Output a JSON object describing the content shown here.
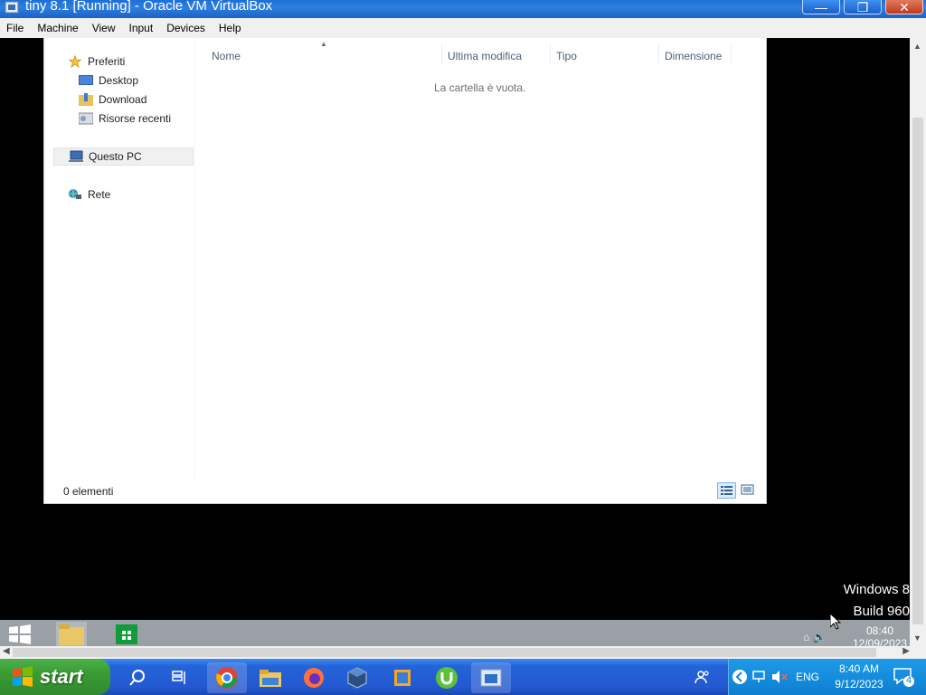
{
  "host_window": {
    "title": "tiny 8.1 [Running] - Oracle VM VirtualBox",
    "minimize_symbol": "—",
    "maximize_symbol": "❐",
    "close_symbol": "✕"
  },
  "menu": [
    "File",
    "Machine",
    "View",
    "Input",
    "Devices",
    "Help"
  ],
  "explorer": {
    "nav": {
      "favorites_label": "Preferiti",
      "desktop_label": "Desktop",
      "download_label": "Download",
      "recent_label": "Risorse recenti",
      "this_pc_label": "Questo PC",
      "network_label": "Rete"
    },
    "columns": {
      "name": "Nome",
      "modified": "Ultima modifica",
      "type": "Tipo",
      "size": "Dimensione"
    },
    "sort_indicator": "▲",
    "empty_message": "La cartella è vuota.",
    "status_count": "0 elementi"
  },
  "guest": {
    "watermark_line1": "Windows 8",
    "watermark_line2": "Build 960",
    "clock_time": "08:40",
    "clock_date": "12/09/2023"
  },
  "host_taskbar": {
    "start_label": "start",
    "language": "ENG",
    "time": "8:40 AM",
    "date": "9/12/2023",
    "notification_count": "4"
  },
  "colors": {
    "host_titlebar": "#1d6fd6",
    "start_green": "#3a9c35",
    "taskbar_blue": "#2358d0",
    "tray_blue": "#0e7fd0"
  }
}
